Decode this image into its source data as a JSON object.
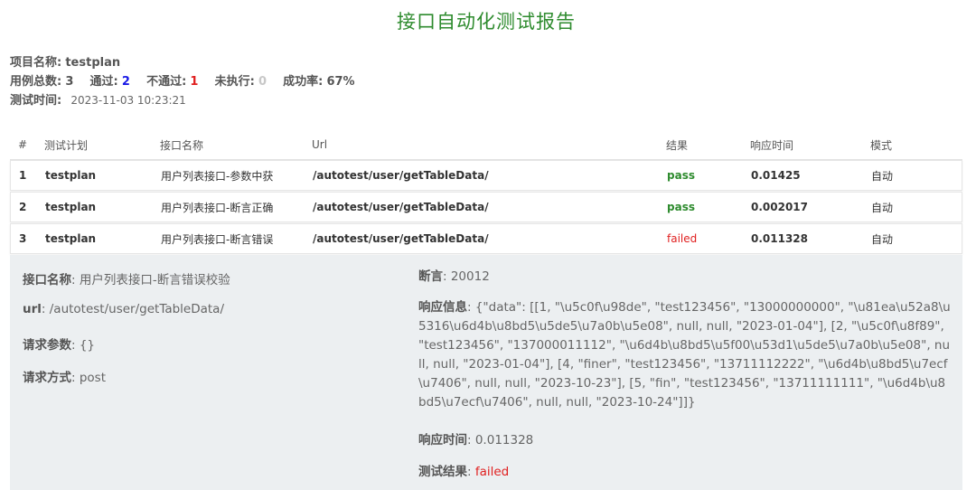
{
  "title": "接口自动化测试报告",
  "summary": {
    "project_label": "项目名称:",
    "project_value": "testplan",
    "total_label": "用例总数:",
    "total_value": "3",
    "pass_label": "通过:",
    "pass_value": "2",
    "fail_label": "不通过:",
    "fail_value": "1",
    "skip_label": "未执行:",
    "skip_value": "0",
    "rate_label": "成功率:",
    "rate_value": "67%",
    "time_label": "测试时间:",
    "time_value": "2023-11-03 10:23:21"
  },
  "table": {
    "headers": {
      "idx": "#",
      "plan": "测试计划",
      "api": "接口名称",
      "url": "Url",
      "result": "结果",
      "time": "响应时间",
      "mode": "模式"
    },
    "rows": [
      {
        "idx": "1",
        "plan": "testplan",
        "api": "用户列表接口-参数中获",
        "url": "/autotest/user/getTableData/",
        "result": "pass",
        "time": "0.01425",
        "mode": "自动"
      },
      {
        "idx": "2",
        "plan": "testplan",
        "api": "用户列表接口-断言正确",
        "url": "/autotest/user/getTableData/",
        "result": "pass",
        "time": "0.002017",
        "mode": "自动"
      },
      {
        "idx": "3",
        "plan": "testplan",
        "api": "用户列表接口-断言错误",
        "url": "/autotest/user/getTableData/",
        "result": "failed",
        "time": "0.011328",
        "mode": "自动"
      }
    ]
  },
  "detail": {
    "api_label": "接口名称",
    "api_value": "用户列表接口-断言错误校验",
    "url_label": "url",
    "url_value": "/autotest/user/getTableData/",
    "params_label": "请求参数",
    "params_value": "{}",
    "method_label": "请求方式",
    "method_value": "post",
    "assert_label": "断言",
    "assert_value": "20012",
    "response_label": "响应信息",
    "response_value": "{\"data\": [[1, \"\\u5c0f\\u98de\", \"test123456\", \"13000000000\", \"\\u81ea\\u52a8\\u5316\\u6d4b\\u8bd5\\u5de5\\u7a0b\\u5e08\", null, null, \"2023-01-04\"], [2, \"\\u5c0f\\u8f89\", \"test123456\", \"137000011112\", \"\\u6d4b\\u8bd5\\u5f00\\u53d1\\u5de5\\u7a0b\\u5e08\", null, null, \"2023-01-04\"], [4, \"finer\", \"test123456\", \"13711112222\", \"\\u6d4b\\u8bd5\\u7ecf\\u7406\", null, null, \"2023-10-23\"], [5, \"fin\", \"test123456\", \"13711111111\", \"\\u6d4b\\u8bd5\\u7ecf\\u7406\", null, null, \"2023-10-24\"]]}",
    "resp_time_label": "响应时间",
    "resp_time_value": "0.011328",
    "result_label": "测试结果",
    "result_value": "failed"
  }
}
